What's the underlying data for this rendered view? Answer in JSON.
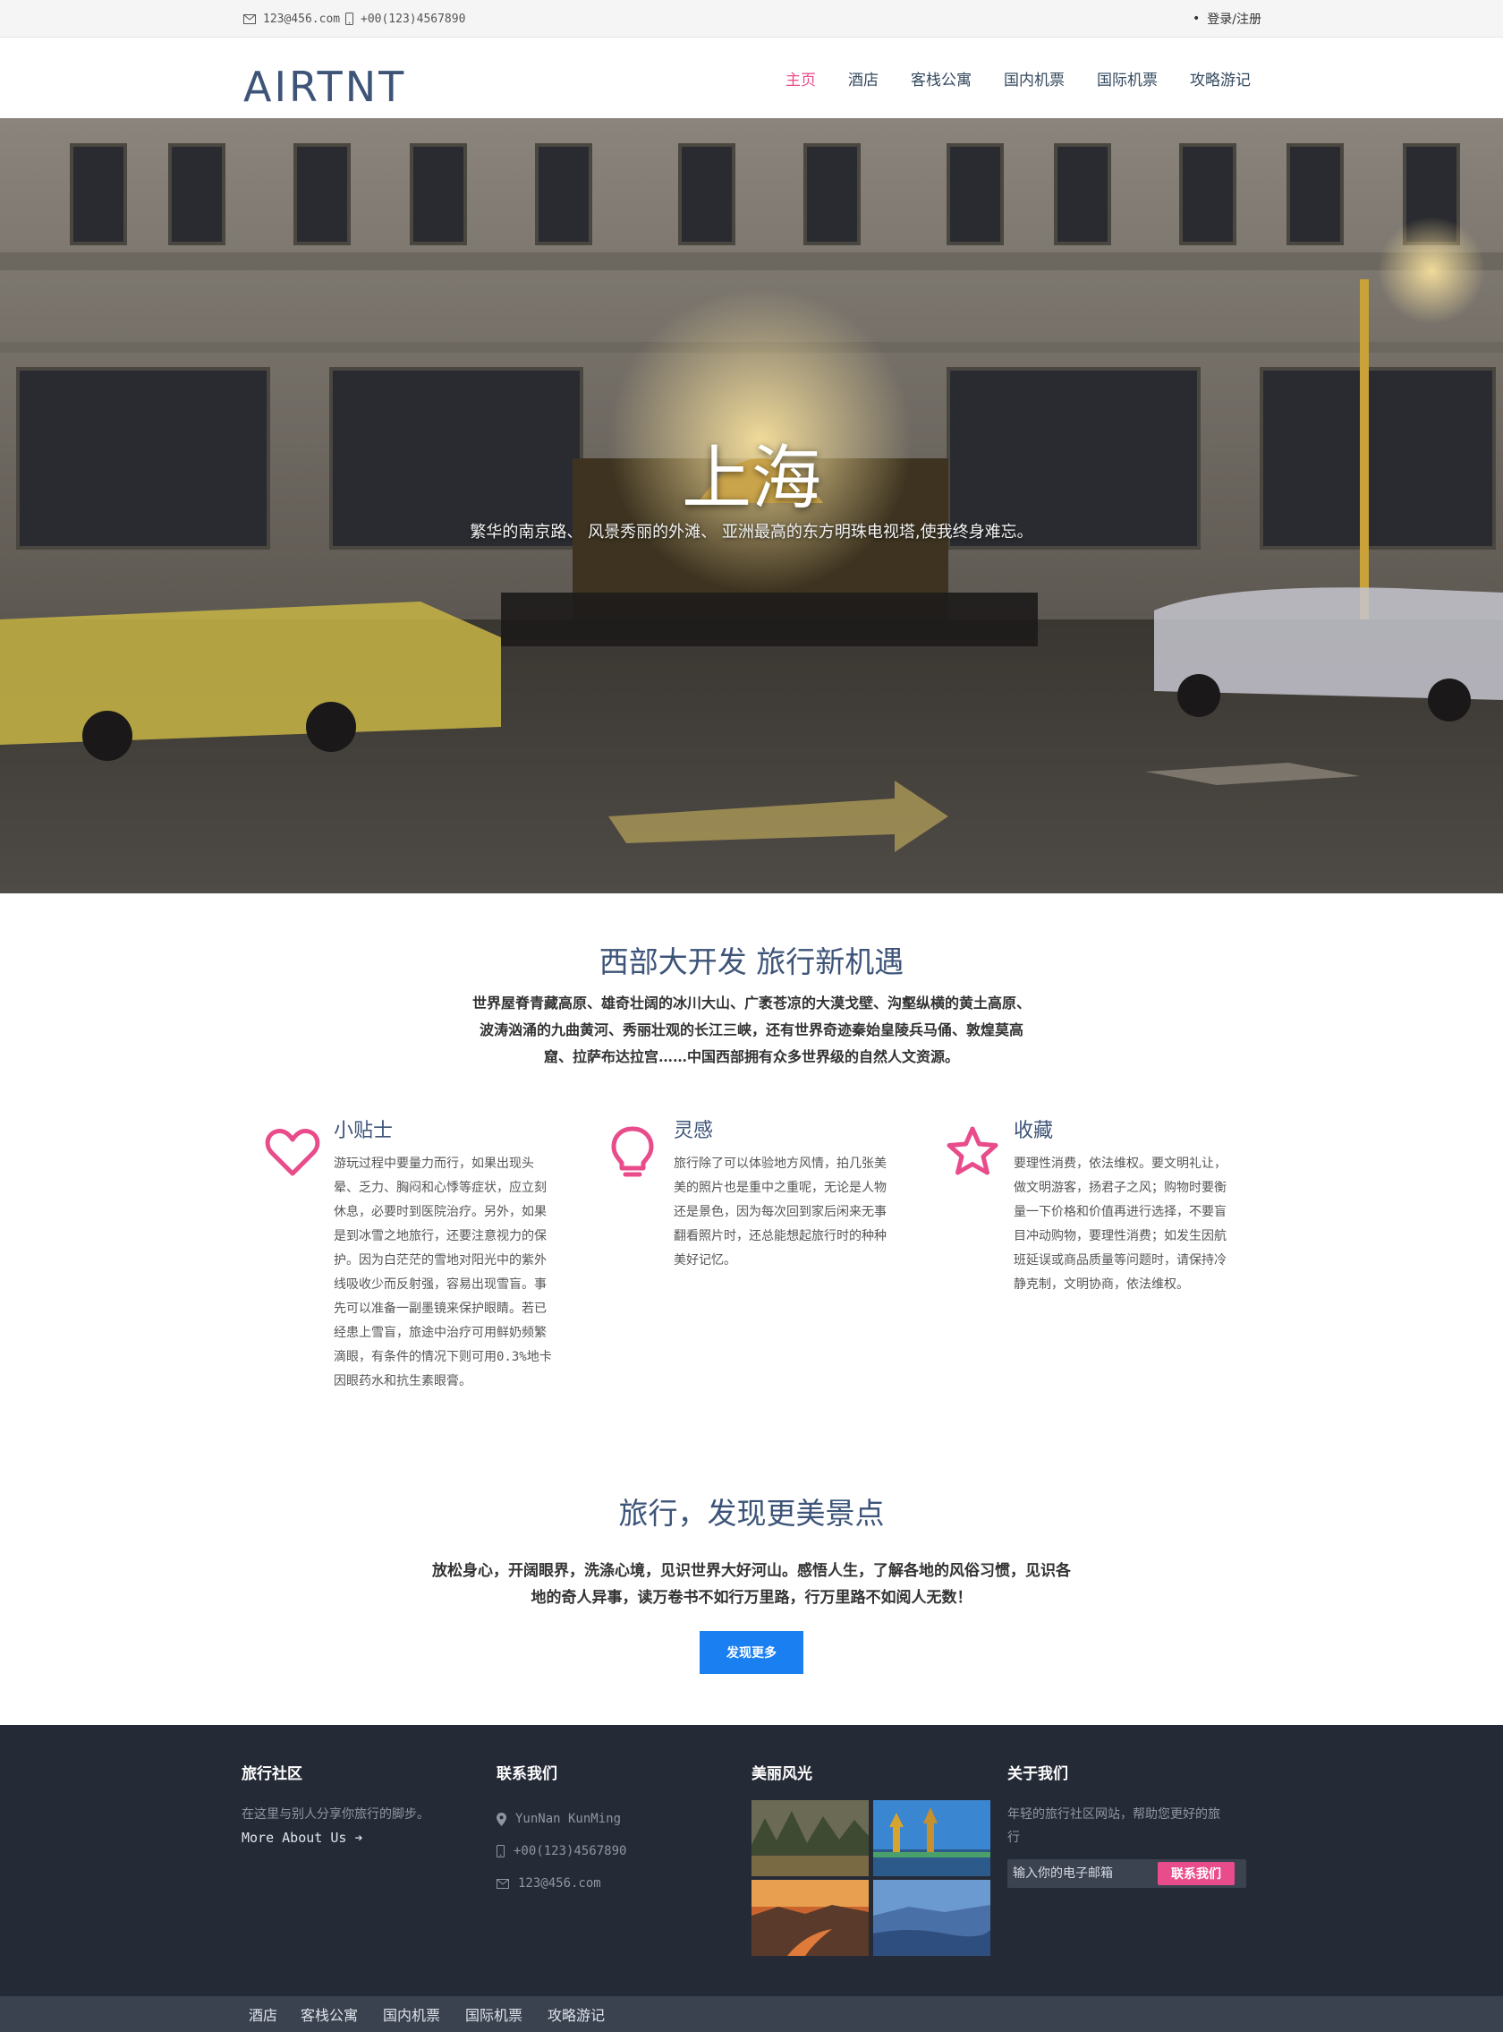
{
  "topbar": {
    "email": "123@456.com",
    "phone": "+00(123)4567890",
    "login": "登录/注册"
  },
  "header": {
    "logo": "AIRTNT",
    "nav": [
      "主页",
      "酒店",
      "客栈公寓",
      "国内机票",
      "国际机票",
      "攻略游记"
    ],
    "active_index": 0
  },
  "hero": {
    "title": "上海",
    "subtitle": "繁华的南京路、 风景秀丽的外滩、 亚洲最高的东方明珠电视塔,使我终身难忘。"
  },
  "intro": {
    "title": "西部大开发  旅行新机遇",
    "lines": [
      "世界屋脊青藏高原、雄奇壮阔的冰川大山、广袤苍凉的大漠戈壁、沟壑纵横的黄土高原、",
      "波涛汹涌的九曲黄河、秀丽壮观的长江三峡，还有世界奇迹秦始皇陵兵马俑、敦煌莫高",
      "窟、拉萨布达拉宫……中国西部拥有众多世界级的自然人文资源。"
    ]
  },
  "features": [
    {
      "icon": "heart-icon",
      "title": "小贴士",
      "lines": [
        "游玩过程中要量力而行，如果出现头",
        "晕、乏力、胸闷和心悸等症状，应立刻",
        "休息，必要时到医院治疗。另外，如果",
        "是到冰雪之地旅行，还要注意视力的保",
        "护。因为白茫茫的雪地对阳光中的紫外",
        "线吸收少而反射强，容易出现雪盲。事",
        "先可以准备一副墨镜来保护眼睛。若已",
        "经患上雪盲，旅途中治疗可用鲜奶频繁",
        "滴眼，有条件的情况下则可用0.3%地卡",
        "因眼药水和抗生素眼膏。"
      ]
    },
    {
      "icon": "lightbulb-icon",
      "title": "灵感",
      "lines": [
        "旅行除了可以体验地方风情，拍几张美",
        "美的照片也是重中之重呢，无论是人物",
        "还是景色，因为每次回到家后闲来无事",
        "翻看照片时，还总能想起旅行时的种种",
        "美好记忆。"
      ]
    },
    {
      "icon": "star-icon",
      "title": "收藏",
      "lines": [
        "要理性消费，依法维权。要文明礼让，",
        "做文明游客，扬君子之风；购物时要衡",
        "量一下价格和价值再进行选择，不要盲",
        "目冲动购物，要理性消费；如发生因航",
        "班延误或商品质量等问题时，请保持冷",
        "静克制，文明协商，依法维权。"
      ]
    }
  ],
  "discover": {
    "title": "旅行，发现更美景点",
    "lines": [
      "放松身心，开阔眼界，洗涤心境，见识世界大好河山。感悟人生，了解各地的风俗习惯，见识各",
      "地的奇人异事，读万卷书不如行万里路，行万里路不如阅人无数！"
    ],
    "button": "发现更多"
  },
  "footer": {
    "community": {
      "title": "旅行社区",
      "text": "在这里与别人分享你旅行的脚步。",
      "link": "More About Us"
    },
    "contact": {
      "title": "联系我们",
      "address": "YunNan KunMing",
      "phone": "+00(123)4567890",
      "email": "123@456.com"
    },
    "gallery": {
      "title": "美丽风光"
    },
    "about": {
      "title": "关于我们",
      "lines": [
        "年轻的旅行社区网站，帮助您更好的旅",
        "行"
      ],
      "email_placeholder": "输入你的电子邮箱",
      "button": "联系我们"
    }
  },
  "bottom_nav": [
    "酒店",
    "客栈公寓",
    "国内机票",
    "国际机票",
    "攻略游记"
  ],
  "colors": {
    "accent": "#e84c8b",
    "brand": "#3d5478",
    "button": "#1a7ff0",
    "footer_bg": "#252b36"
  }
}
